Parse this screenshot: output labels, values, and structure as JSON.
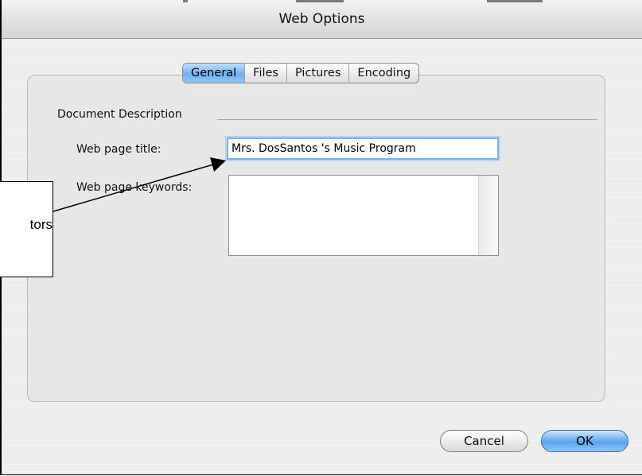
{
  "window": {
    "title": "Web Options"
  },
  "tabs": [
    {
      "label": "General",
      "active": true
    },
    {
      "label": "Files",
      "active": false
    },
    {
      "label": "Pictures",
      "active": false
    },
    {
      "label": "Encoding",
      "active": false
    }
  ],
  "section": {
    "label": "Document Description"
  },
  "fields": {
    "title_label": "Web page title:",
    "title_value": "Mrs. DosSantos 's Music Program",
    "keywords_label": "Web page keywords:",
    "keywords_value": ""
  },
  "callout": {
    "text": "tors"
  },
  "buttons": {
    "cancel": "Cancel",
    "ok": "OK"
  },
  "colors": {
    "accent": "#6fb1ef",
    "focus_ring": "#7fb2ee"
  }
}
